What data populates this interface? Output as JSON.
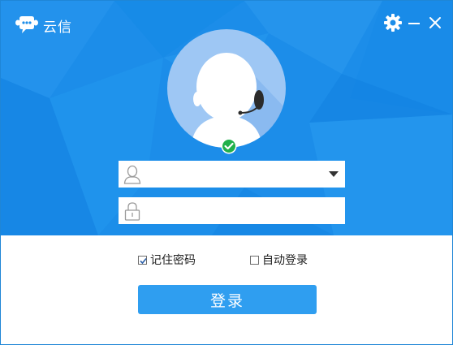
{
  "app": {
    "title": "云信"
  },
  "controls": {
    "settings_icon": "gear-icon",
    "minimize_icon": "minimize-icon",
    "close_icon": "close-icon"
  },
  "login": {
    "username": {
      "value": "",
      "placeholder": ""
    },
    "password": {
      "value": "",
      "placeholder": ""
    },
    "remember_password": {
      "label": "记住密码",
      "checked": true
    },
    "auto_login": {
      "label": "自动登录",
      "checked": false
    },
    "submit_label": "登录"
  },
  "status": {
    "online": true
  },
  "colors": {
    "header_blue": "#1c8de9",
    "button_blue": "#2f9ef0",
    "status_green": "#21b04b"
  }
}
